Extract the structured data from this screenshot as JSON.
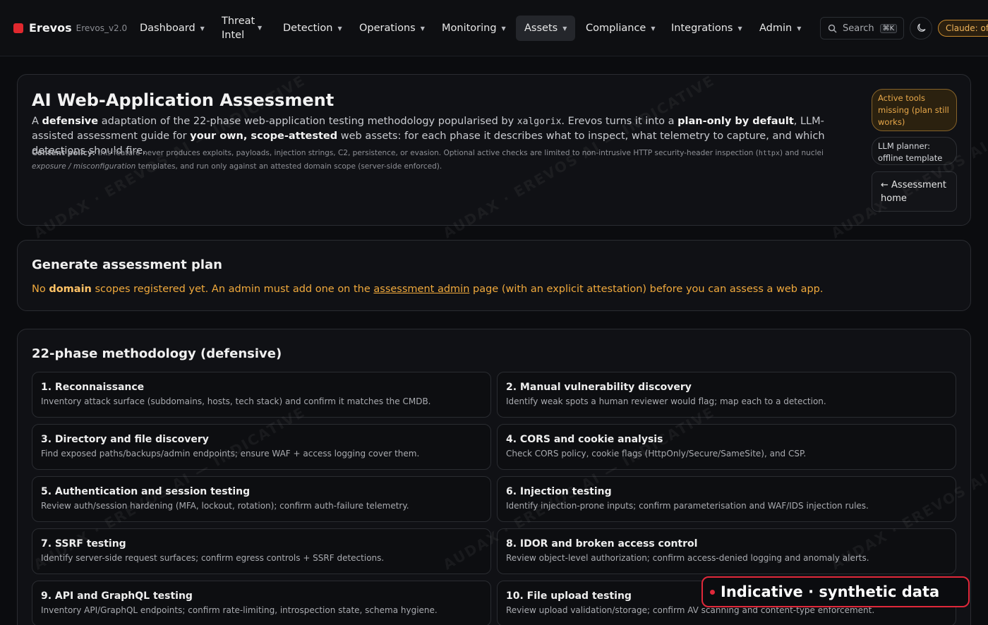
{
  "brand": {
    "name": "Erevos",
    "version": "Erevos_v2.0",
    "color": "#e0282e"
  },
  "nav": {
    "items": [
      {
        "label": "Dashboard"
      },
      {
        "label": "Threat Intel"
      },
      {
        "label": "Detection"
      },
      {
        "label": "Operations"
      },
      {
        "label": "Monitoring"
      },
      {
        "label": "Assets",
        "active": true
      },
      {
        "label": "Compliance"
      },
      {
        "label": "Integrations"
      },
      {
        "label": "Admin"
      }
    ],
    "search_label": "Search",
    "search_shortcut": "⌘K",
    "theme_icon": "moon-icon",
    "claude_status": "Claude: offline"
  },
  "header": {
    "title": "AI Web-Application Assessment",
    "intro_1": "A ",
    "intro_defensive": "defensive",
    "intro_2": " adaptation of the 22-phase web-application testing methodology popularised by ",
    "intro_code": "xalgorix",
    "intro_3": ". Erevos turns it into a ",
    "intro_plan": "plan-only by default",
    "intro_4": ", LLM-assisted assessment guide for ",
    "intro_own": "your own, scope-attested",
    "intro_5": " web assets: for each phase it describes what to inspect, what telemetry to capture, and which detections should fire.",
    "policy_label": "Content policy:",
    "policy_1": " this feature never produces exploits, payloads, injection strings, C2, persistence, or evasion. Optional active checks are limited to non-intrusive HTTP security-header inspection (",
    "policy_code": "httpx",
    "policy_2": ") and nuclei ",
    "policy_em": "exposure / misconfiguration",
    "policy_3": " templates, and run only against an attested domain scope (server-side enforced).",
    "pill_warn": "Active tools missing (plan still works)",
    "pill_llm": "LLM planner: offline template",
    "home_button": "← Assessment home"
  },
  "plan": {
    "title": "Generate assessment plan",
    "notice_1": "No ",
    "notice_domain": "domain",
    "notice_2": " scopes registered yet. An admin must add one on the ",
    "notice_link": "assessment admin",
    "notice_3": " page (with an explicit attestation) before you can assess a web app."
  },
  "methodology": {
    "title": "22-phase methodology (defensive)",
    "phases": [
      {
        "title": "1. Reconnaissance",
        "desc": "Inventory attack surface (subdomains, hosts, tech stack) and confirm it matches the CMDB."
      },
      {
        "title": "2. Manual vulnerability discovery",
        "desc": "Identify weak spots a human reviewer would flag; map each to a detection."
      },
      {
        "title": "3. Directory and file discovery",
        "desc": "Find exposed paths/backups/admin endpoints; ensure WAF + access logging cover them."
      },
      {
        "title": "4. CORS and cookie analysis",
        "desc": "Check CORS policy, cookie flags (HttpOnly/Secure/SameSite), and CSP."
      },
      {
        "title": "5. Authentication and session testing",
        "desc": "Review auth/session hardening (MFA, lockout, rotation); confirm auth-failure telemetry."
      },
      {
        "title": "6. Injection testing",
        "desc": "Identify injection-prone inputs; confirm parameterisation and WAF/IDS injection rules."
      },
      {
        "title": "7. SSRF testing",
        "desc": "Identify server-side request surfaces; confirm egress controls + SSRF detections."
      },
      {
        "title": "8. IDOR and broken access control",
        "desc": "Review object-level authorization; confirm access-denied logging and anomaly alerts."
      },
      {
        "title": "9. API and GraphQL testing",
        "desc": "Inventory API/GraphQL endpoints; confirm rate-limiting, introspection state, schema hygiene."
      },
      {
        "title": "10. File upload testing",
        "desc": "Review upload validation/storage; confirm AV scanning and content-type enforcement."
      }
    ]
  },
  "watermark": "AUDAX · EREVOS AI — INDICATIVE",
  "badge": {
    "label": "Indicative · synthetic data",
    "color": "#e0283a"
  }
}
